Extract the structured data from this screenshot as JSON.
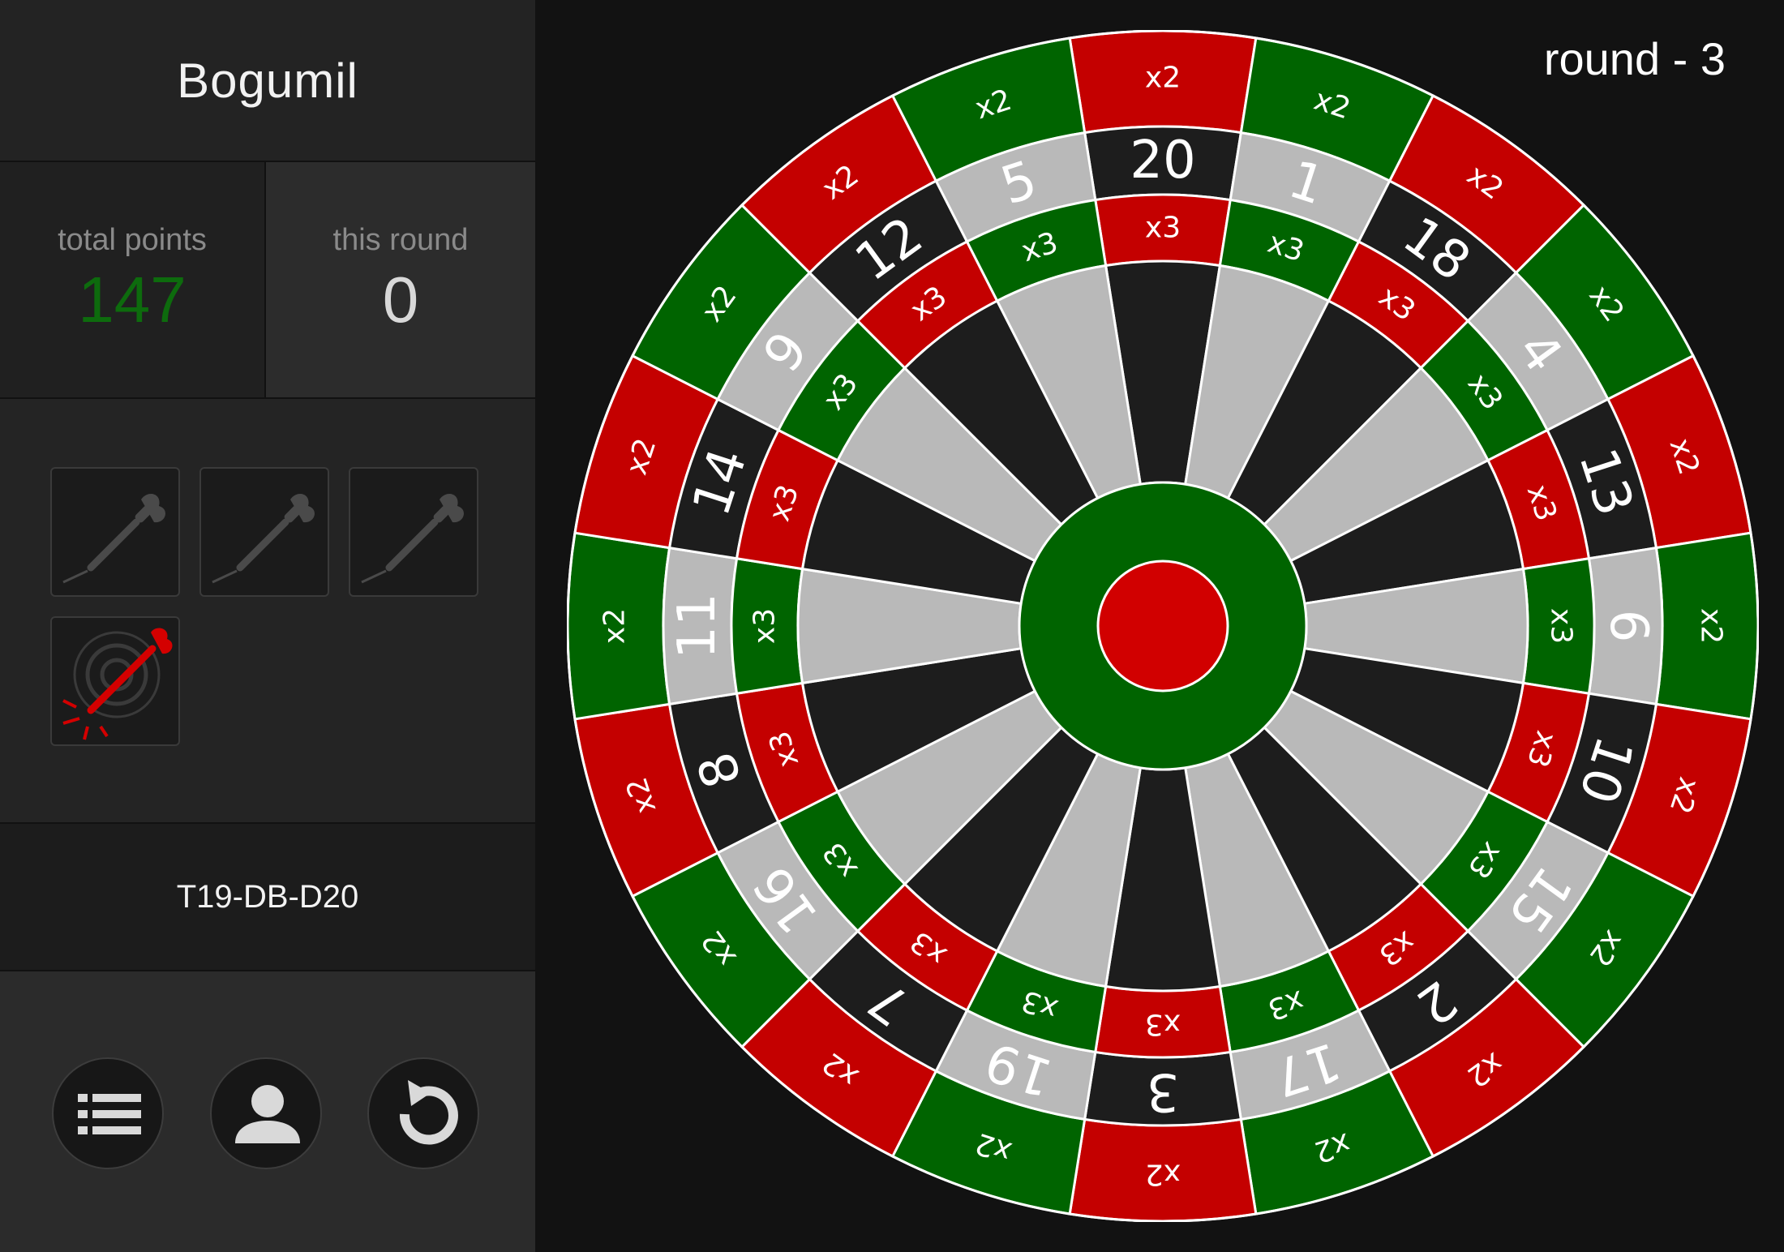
{
  "player": {
    "name": "Bogumil"
  },
  "stats": {
    "total_label": "total points",
    "total_value": "147",
    "round_label": "this round",
    "round_value": "0"
  },
  "darts": [
    {
      "state": "unused",
      "icon": "dart-icon"
    },
    {
      "state": "unused",
      "icon": "dart-icon"
    },
    {
      "state": "unused",
      "icon": "dart-icon"
    },
    {
      "state": "missed",
      "icon": "dart-miss-icon"
    }
  ],
  "checkout": {
    "hint": "T19-DB-D20"
  },
  "controls": [
    {
      "name": "scoreboard-button",
      "icon": "list-icon"
    },
    {
      "name": "player-button",
      "icon": "person-icon"
    },
    {
      "name": "undo-button",
      "icon": "undo-icon"
    }
  ],
  "round": {
    "label": "round - 3"
  },
  "board": {
    "numbers": [
      20,
      1,
      18,
      4,
      13,
      6,
      10,
      15,
      2,
      17,
      3,
      19,
      7,
      16,
      8,
      11,
      14,
      9,
      12,
      5
    ],
    "double_label": "x2",
    "triple_label": "x3",
    "colors": {
      "dark": "#1d1d1d",
      "light": "#b9b9b9",
      "red": "#c40000",
      "green": "#006400",
      "outer_bull": "#006400",
      "bullseye": "#d10000",
      "wire": "#ffffff"
    }
  }
}
